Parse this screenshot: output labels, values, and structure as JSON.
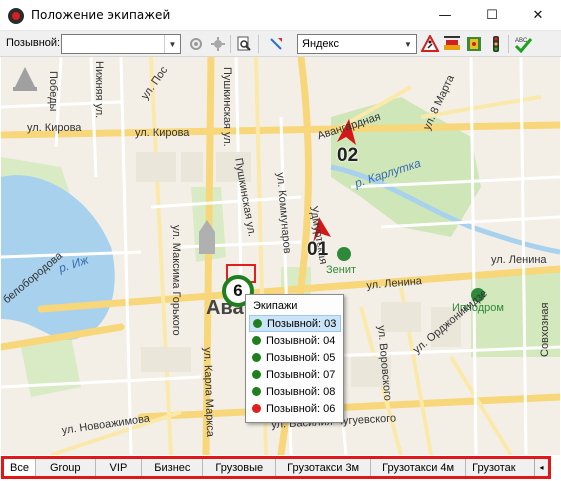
{
  "window": {
    "title": "Положение экипажей",
    "minimize_glyph": "—",
    "maximize_glyph": "☐",
    "close_glyph": "✕"
  },
  "toolbar": {
    "callsign_label": "Позывной:",
    "callsign_value": "",
    "map_provider": "Яндекс",
    "icons": [
      "target-gray-icon",
      "gear-gray-icon",
      "zoom-page-icon",
      "pick-pointer-icon",
      "road-works-icon",
      "traffic-jam-icon",
      "traffic-light-icon",
      "spell-check-icon"
    ]
  },
  "map": {
    "streets": {
      "pobedy": "Победы",
      "nizhnyaya": "Нижняя ул.",
      "pos": "ул. Пос",
      "kirova_left": "ул. Кирова",
      "kirova_right": "ул. Кирова",
      "pushkinskaya_1": "Пушкинская ул.",
      "pushkinskaya_2": "Пушкинская ул.",
      "kommunarov": "ул. Коммунаров",
      "avangardnaya": "Авангардная",
      "marta": "ул. 8 Марта",
      "karlutka": "р. Карлутка",
      "udmurtskaya": "Удмуртская",
      "izh": "р. Иж",
      "maksima_gorkogo": "ул. Максима Горького",
      "lenina_1": "ул. Ленина",
      "lenina_2": "ул. Ленина",
      "zenit": "Зенит",
      "ippodrom": "Ипподром",
      "belobor": "белобородова",
      "karla_marksa": "ул. Карла Маркса",
      "vorovskogo": "ул. Воровского",
      "ordzhonikidze": "ул. Орджоникидзе",
      "sovkhoznaya": "Совхозная",
      "novoazhimova": "ул. Новоажимова",
      "chugueskogo": "ул. Василия Чугуевского",
      "city_label": "Авар"
    },
    "cars": [
      {
        "label": "02"
      },
      {
        "label": "01"
      }
    ],
    "cluster": {
      "count": "6"
    },
    "popup": {
      "title": "Экипажи",
      "items": [
        {
          "label": "Позывной: 03",
          "color": "#1f7f1f",
          "selected": true
        },
        {
          "label": "Позывной: 04",
          "color": "#1f7f1f",
          "selected": false
        },
        {
          "label": "Позывной: 05",
          "color": "#1f7f1f",
          "selected": false
        },
        {
          "label": "Позывной: 07",
          "color": "#1f7f1f",
          "selected": false
        },
        {
          "label": "Позывной: 08",
          "color": "#1f7f1f",
          "selected": false
        },
        {
          "label": "Позывной: 06",
          "color": "#e02020",
          "selected": false
        }
      ]
    }
  },
  "tabs": [
    "Все",
    "Group",
    "VIP",
    "Бизнес",
    "Грузовые",
    "Грузотакси 3м",
    "Грузотакси 4м",
    "Грузотак"
  ],
  "tabs_scroll_glyph": "◂"
}
